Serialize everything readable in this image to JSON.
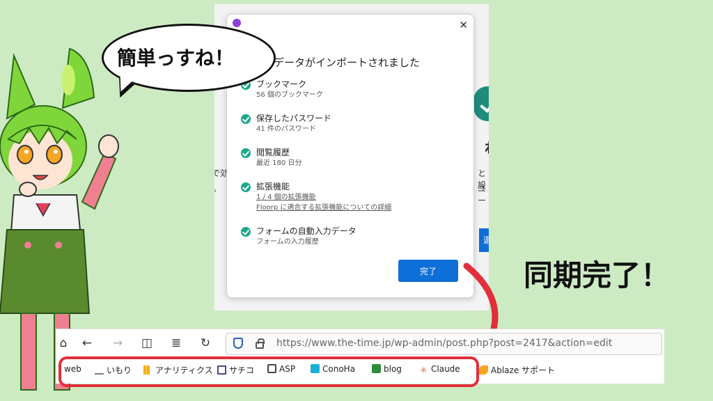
{
  "dialog": {
    "title": "のデータがインポートされました",
    "close_icon": "✕",
    "items": [
      {
        "title": "ブックマーク",
        "sub": "56 個のブックマーク"
      },
      {
        "title": "保存したパスワード",
        "sub": "41 件のパスワード"
      },
      {
        "title": "閲覧履歴",
        "sub": "最近 180 日分"
      },
      {
        "title": "拡張機能",
        "link1": "1 / 4 個の拡張機能",
        "link2": "Floorp に適合する拡張機能についての詳細"
      },
      {
        "title": "フォームの自動入力データ",
        "sub": "フォームの入力履歴"
      }
    ],
    "done_label": "完了"
  },
  "background_fragments": {
    "left1": "で効",
    "left2": "。",
    "right1": "と設",
    "right2": "ユー",
    "right_big": "ね",
    "right_btn": "選"
  },
  "browser": {
    "url": "https://www.the-time.jp/wp-admin/post.php?post=2417&action=edit",
    "bookmarks": [
      "web",
      "いもり",
      "アナリティクス",
      "サチコ",
      "ASP",
      "ConoHa",
      "blog",
      "Claude",
      "Ablaze サポート"
    ]
  },
  "bubble_text": "簡単っすね！",
  "sync_text": "同期完了！",
  "colors": {
    "background": "#cdebc3",
    "accent_blue": "#0f6fd8",
    "check_green": "#1aa88a",
    "highlight_red": "#e0303b"
  }
}
